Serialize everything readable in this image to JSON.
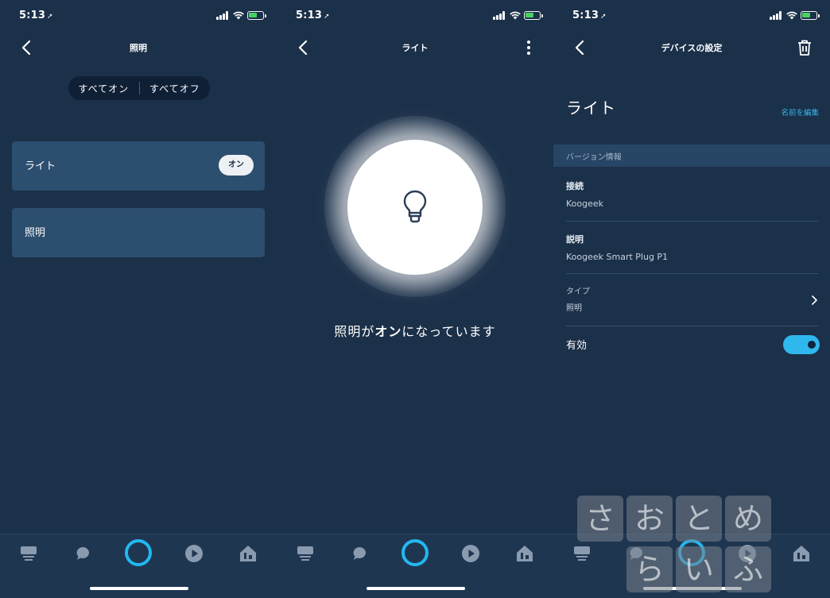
{
  "status_bar": {
    "time": "5:13",
    "location_arrow": "➚"
  },
  "screen1": {
    "title": "照明",
    "all_on": "すべてオン",
    "all_off": "すべてオフ",
    "devices": [
      {
        "name": "ライト",
        "state_pill": "オン"
      },
      {
        "name": "照明"
      }
    ]
  },
  "screen2": {
    "title": "ライト",
    "state_prefix": "照明が",
    "state_value": "オン",
    "state_suffix": "になっています"
  },
  "screen3": {
    "title": "デバイスの設定",
    "device_name": "ライト",
    "edit_name": "名前を編集",
    "section": "バージョン情報",
    "rows": [
      {
        "label": "接続",
        "value": "Koogeek"
      },
      {
        "label": "説明",
        "value": "Koogeek Smart Plug P1"
      },
      {
        "label": "タイプ",
        "value": "照明"
      }
    ],
    "enabled_label": "有効",
    "enabled": true
  },
  "nav": {
    "items": [
      "home-icon",
      "chat-icon",
      "alexa-ring-icon",
      "play-icon",
      "devices-icon"
    ]
  },
  "watermark": [
    "さ",
    "お",
    "と",
    "め",
    "ら",
    "い",
    "ふ"
  ],
  "colors": {
    "background": "#1b3049",
    "card": "#2c4e6f",
    "accent": "#2fb8ee"
  }
}
